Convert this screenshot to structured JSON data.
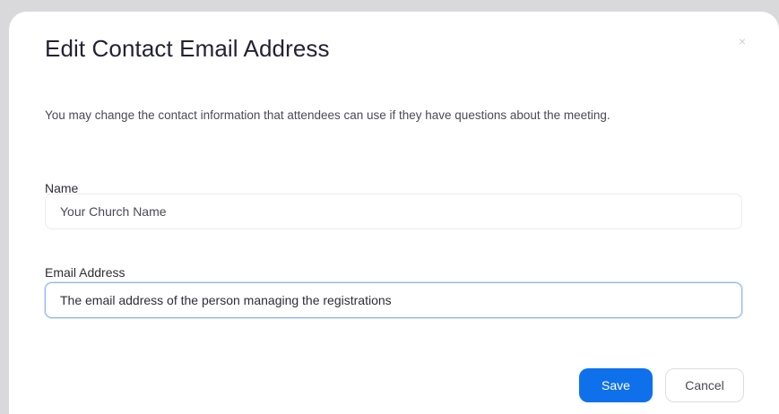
{
  "dialog": {
    "title": "Edit Contact Email Address",
    "close_glyph": "×",
    "description": "You may change the contact information that attendees can use if they have questions about the meeting.",
    "name_label": "Name",
    "name_value": "Your Church Name",
    "email_label": "Email Address",
    "email_value": "The email address of the person managing the registrations",
    "save_label": "Save",
    "cancel_label": "Cancel"
  },
  "colors": {
    "accent": "#0e71eb",
    "text": "#232333",
    "background": "#d9d9db"
  }
}
